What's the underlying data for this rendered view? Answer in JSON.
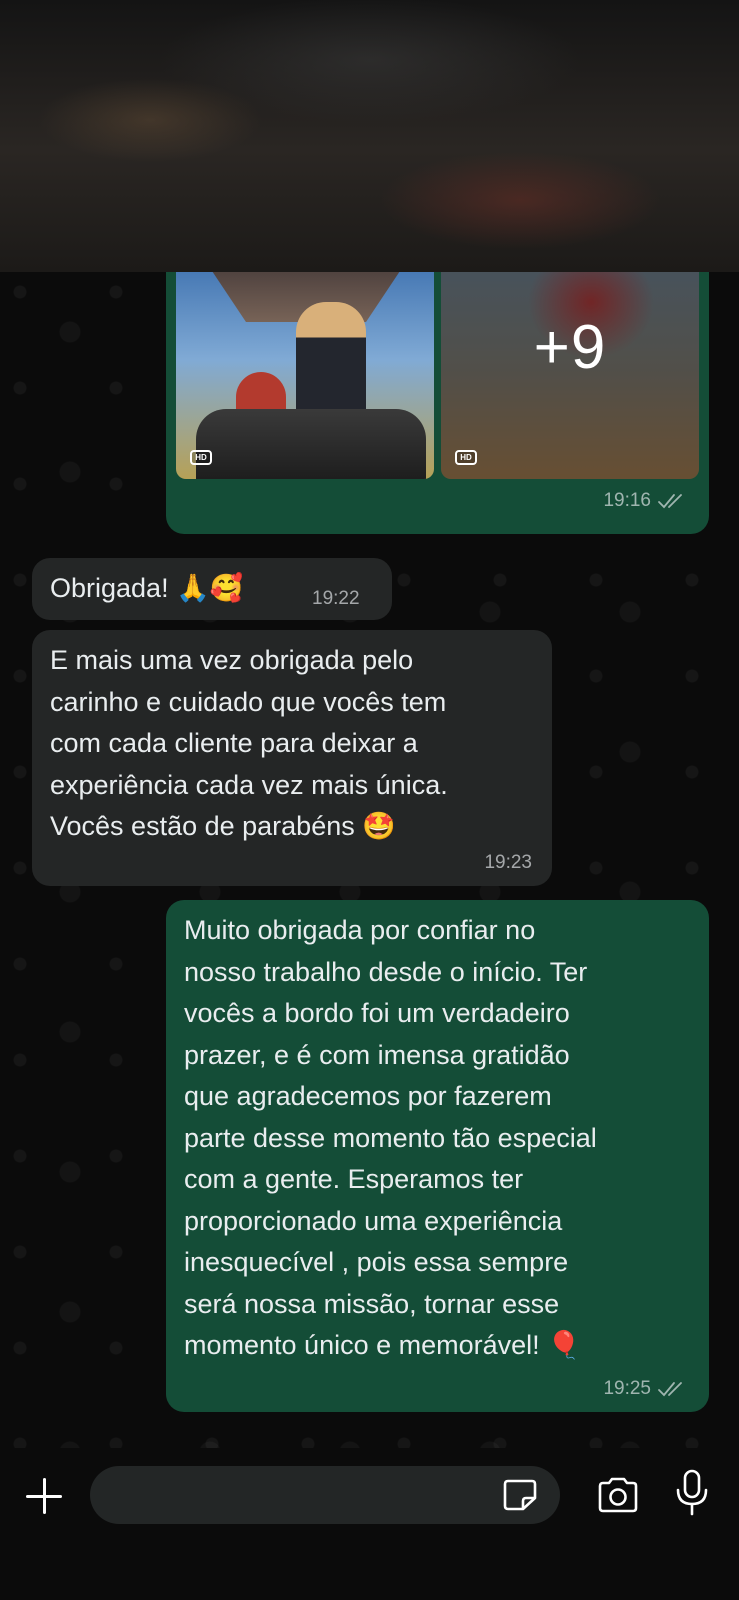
{
  "media_message": {
    "more_count": "+9",
    "photo_badge_1": "HD",
    "photo_badge_2": "HD",
    "time": "19:16",
    "status": "read"
  },
  "messages": [
    {
      "direction": "incoming",
      "text": "Obrigada! 🙏🥰",
      "time": "19:22"
    },
    {
      "direction": "incoming",
      "lines": [
        "E mais uma vez obrigada pelo",
        "carinho e cuidado que vocês tem",
        "com cada cliente para deixar a",
        "experiência cada vez mais única.",
        "Vocês estão de parabéns 🤩"
      ],
      "time": "19:23"
    },
    {
      "direction": "outgoing",
      "lines": [
        "Muito obrigada por confiar no",
        "nosso trabalho desde o início. Ter",
        "vocês a bordo foi um verdadeiro",
        "prazer, e é com imensa gratidão",
        "que agradecemos por fazerem",
        "parte desse momento tão especial",
        "com a gente. Esperamos ter",
        "proporcionado uma experiência",
        "inesquecível , pois essa sempre",
        "será nossa missão, tornar esse",
        "momento único e memorável! 🎈"
      ],
      "time": "19:25",
      "status": "read"
    }
  ],
  "composer": {
    "placeholder": "",
    "value": ""
  },
  "colors": {
    "outgoing_bubble": "#144d37",
    "incoming_bubble": "#242626",
    "background": "#0b0b0b"
  },
  "icons": [
    "plus-icon",
    "sticker-icon",
    "camera-icon",
    "microphone-icon",
    "double-check-icon"
  ]
}
